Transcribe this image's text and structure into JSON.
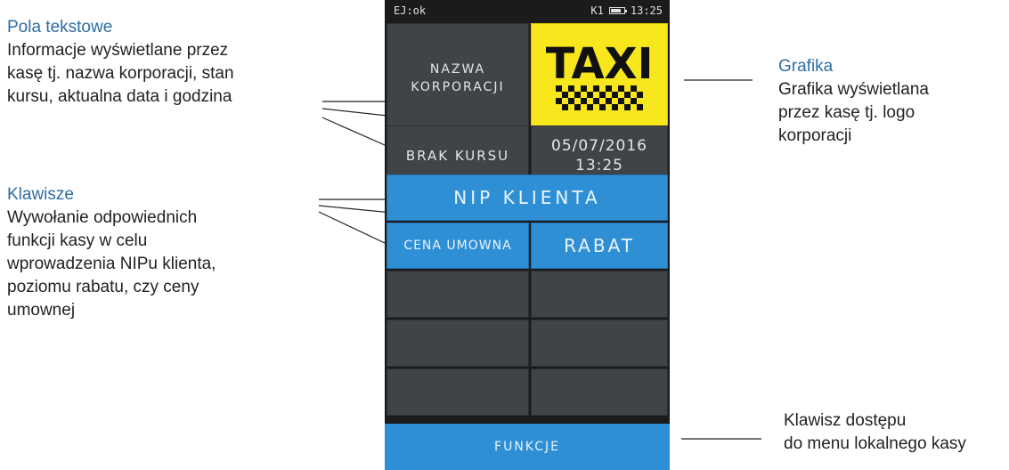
{
  "annotations": {
    "text_fields": {
      "title": "Pola tekstowe",
      "lines": [
        "Informacje wyświetlane przez",
        "kasę tj. nazwa korporacji, stan",
        "kursu, aktualna data i godzina"
      ]
    },
    "keys": {
      "title": "Klawisze",
      "lines": [
        "Wywołanie odpowiednich",
        "funkcji kasy w celu",
        "wprowadzenia NIPu klienta,",
        "poziomu rabatu, czy ceny",
        "umownej"
      ]
    },
    "graphics": {
      "title": "Grafika",
      "lines": [
        "Grafika wyświetlana",
        "przez kasę tj. logo",
        "korporacji"
      ]
    },
    "menu_key": {
      "lines": [
        "Klawisz dostępu",
        "do menu lokalnego kasy"
      ]
    }
  },
  "device": {
    "status_left": "EJ:ok",
    "status_k": "K1",
    "status_time": "13:25",
    "battery_level": 0.75,
    "company_name_line1": "NAZWA",
    "company_name_line2": "KORPORACJI",
    "logo_text": "TAXI",
    "trip_status": "BRAK KURSU",
    "date": "05/07/2016",
    "time": "13:25",
    "nip_button": "NIP KLIENTA",
    "contract_price_button": "CENA UMOWNA",
    "discount_button": "RABAT",
    "functions_button": "FUNKCJE"
  },
  "colors": {
    "annotation_title": "#2e6da4",
    "tile_dark": "#3f4449",
    "tile_blue": "#2f8fd5",
    "logo_bg": "#f8e71c"
  }
}
